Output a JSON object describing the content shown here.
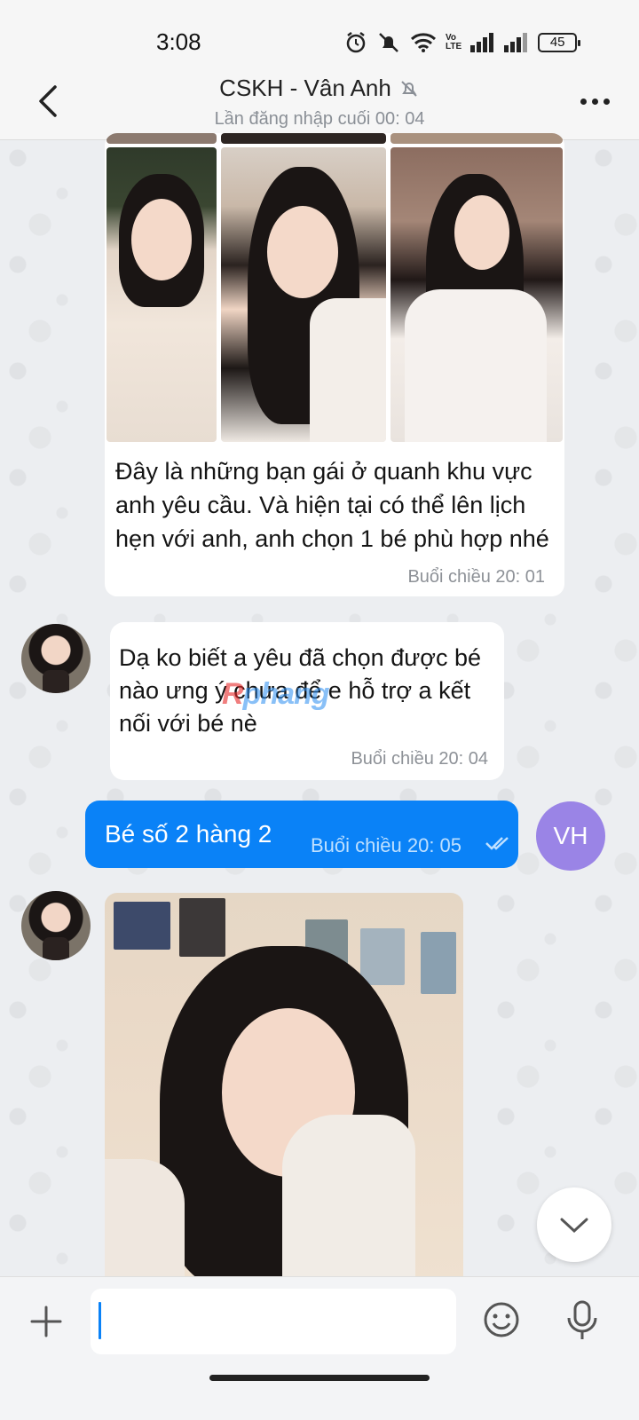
{
  "status_bar": {
    "time": "3:08",
    "volte": "Vo\nLTE",
    "battery": "45"
  },
  "header": {
    "title": "CSKH - Vân Anh",
    "subtitle": "Lần đăng nhập cuối 00: 04"
  },
  "messages": [
    {
      "kind": "album_with_text",
      "text": "Đây là những bạn gái ở quanh khu vực anh yêu cầu. Và hiện tại có thể lên lịch hẹn với anh, anh chọn 1 bé phù hợp nhé",
      "time": "Buổi chiều  20: 01"
    },
    {
      "kind": "incoming_text",
      "text": "Dạ ko biết a yêu đã chọn được bé nào ưng ý chưa để e hỗ trợ a kết nối với bé nè",
      "time": "Buổi chiều  20: 04"
    },
    {
      "kind": "outgoing_text",
      "text": "Bé số 2 hàng 2",
      "time": "Buổi chiều  20: 05",
      "avatar_initials": "VH"
    },
    {
      "kind": "incoming_photo"
    }
  ],
  "watermark": {
    "part1": "R",
    "part2": "phang"
  },
  "input": {
    "placeholder": ""
  },
  "colors": {
    "accent": "#0a82f7",
    "avatar_vh": "#9a84e6"
  },
  "icons": [
    "back-arrow-icon",
    "muted-bell-icon",
    "more-icon",
    "double-check-icon",
    "chevron-down-icon",
    "plus-icon",
    "emoji-icon",
    "microphone-icon"
  ]
}
